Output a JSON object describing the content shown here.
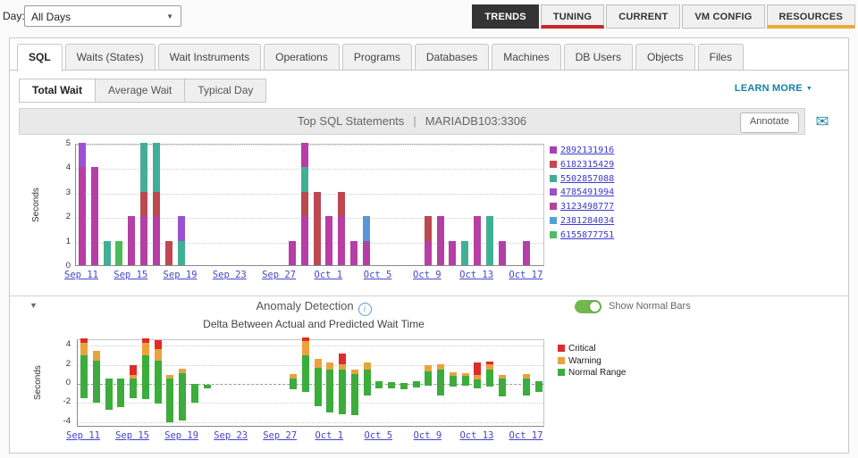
{
  "toolbar": {
    "day_label": "Day:",
    "day_value": "All Days",
    "nav_buttons": [
      {
        "label": "TRENDS",
        "active": true
      },
      {
        "label": "TUNING",
        "accent": "#C9252C"
      },
      {
        "label": "CURRENT"
      },
      {
        "label": "VM CONFIG"
      },
      {
        "label": "RESOURCES",
        "accent": "#EFA93B"
      }
    ]
  },
  "tabs": [
    "SQL",
    "Waits (States)",
    "Wait Instruments",
    "Operations",
    "Programs",
    "Databases",
    "Machines",
    "DB Users",
    "Objects",
    "Files"
  ],
  "active_tab": "SQL",
  "subtabs": [
    "Total Wait",
    "Average Wait",
    "Typical Day"
  ],
  "active_subtab": "Total Wait",
  "learn_more": {
    "label": "LEARN MORE"
  },
  "panel": {
    "title_left": "Top SQL Statements",
    "title_sep": "|",
    "title_right": "MARIADB103:3306",
    "annotate_label": "Annotate"
  },
  "anomaly": {
    "title": "Anomaly Detection",
    "toggle_label": "Show Normal Bars",
    "toggle_state": "on",
    "subtitle": "Delta Between Actual and Predicted Wait Time"
  },
  "icons": {
    "email": "✉",
    "caret": "▼",
    "collapse": "▼",
    "info": "i"
  },
  "chart_data": [
    {
      "type": "bar",
      "stacked": true,
      "title": "Top SQL Statements | MARIADB103:3306",
      "ylabel": "Seconds",
      "ylim": [
        0,
        5.2
      ],
      "yticks": [
        0,
        1,
        2,
        3,
        4,
        5
      ],
      "n_slots": 38,
      "tick_labels": [
        "Sep 11",
        "Sep 15",
        "Sep 19",
        "Sep 23",
        "Sep 27",
        "Oct 1",
        "Oct 5",
        "Oct 9",
        "Oct 13",
        "Oct 17"
      ],
      "tick_slots": [
        0,
        4,
        8,
        12,
        16,
        20,
        24,
        28,
        32,
        36
      ],
      "colors": {
        "magenta": "#B53FA5",
        "red": "#BB4A50",
        "teal": "#43AE96",
        "purple": "#9C52CE",
        "green": "#4CBB57",
        "blue": "#5599DB"
      },
      "legend": [
        {
          "label": "2892131916",
          "color": "#A93FB8"
        },
        {
          "label": "6182315429",
          "color": "#C44A4A"
        },
        {
          "label": "5502857088",
          "color": "#3EAE93"
        },
        {
          "label": "4785491994",
          "color": "#9C4FCB"
        },
        {
          "label": "3123498777",
          "color": "#B83FA0"
        },
        {
          "label": "2381284034",
          "color": "#55A0D9"
        },
        {
          "label": "6155877751",
          "color": "#4CBE63"
        }
      ],
      "bars": [
        {
          "slot": 0,
          "segments": [
            [
              "magenta",
              4
            ],
            [
              "purple",
              1
            ]
          ]
        },
        {
          "slot": 1,
          "segments": [
            [
              "magenta",
              4
            ]
          ]
        },
        {
          "slot": 2,
          "segments": [
            [
              "teal",
              1
            ]
          ]
        },
        {
          "slot": 3,
          "segments": [
            [
              "green",
              1
            ]
          ]
        },
        {
          "slot": 4,
          "segments": [
            [
              "magenta",
              2
            ]
          ]
        },
        {
          "slot": 5,
          "segments": [
            [
              "magenta",
              2
            ],
            [
              "red",
              1
            ],
            [
              "teal",
              2
            ]
          ]
        },
        {
          "slot": 6,
          "segments": [
            [
              "magenta",
              2
            ],
            [
              "red",
              1
            ],
            [
              "teal",
              2
            ]
          ]
        },
        {
          "slot": 7,
          "segments": [
            [
              "red",
              1
            ]
          ]
        },
        {
          "slot": 8,
          "segments": [
            [
              "teal",
              1
            ],
            [
              "purple",
              1
            ]
          ]
        },
        {
          "slot": 17,
          "segments": [
            [
              "magenta",
              1
            ]
          ]
        },
        {
          "slot": 18,
          "segments": [
            [
              "magenta",
              2
            ],
            [
              "red",
              1
            ],
            [
              "teal",
              1
            ],
            [
              "magenta",
              1
            ]
          ]
        },
        {
          "slot": 19,
          "segments": [
            [
              "red",
              3
            ]
          ]
        },
        {
          "slot": 20,
          "segments": [
            [
              "magenta",
              2
            ]
          ]
        },
        {
          "slot": 21,
          "segments": [
            [
              "magenta",
              2
            ],
            [
              "red",
              1
            ]
          ]
        },
        {
          "slot": 22,
          "segments": [
            [
              "magenta",
              1
            ]
          ]
        },
        {
          "slot": 23,
          "segments": [
            [
              "magenta",
              1
            ],
            [
              "blue",
              1
            ]
          ]
        },
        {
          "slot": 28,
          "segments": [
            [
              "magenta",
              1
            ],
            [
              "red",
              1
            ]
          ]
        },
        {
          "slot": 29,
          "segments": [
            [
              "magenta",
              2
            ]
          ]
        },
        {
          "slot": 30,
          "segments": [
            [
              "magenta",
              1
            ]
          ]
        },
        {
          "slot": 31,
          "segments": [
            [
              "teal",
              1
            ]
          ]
        },
        {
          "slot": 32,
          "segments": [
            [
              "magenta",
              2
            ]
          ]
        },
        {
          "slot": 33,
          "segments": [
            [
              "teal",
              2
            ]
          ]
        },
        {
          "slot": 34,
          "segments": [
            [
              "magenta",
              1
            ]
          ]
        },
        {
          "slot": 36,
          "segments": [
            [
              "magenta",
              1
            ]
          ]
        }
      ]
    },
    {
      "type": "bar",
      "subtype": "diverging-stacked",
      "title": "Delta Between Actual and Predicted Wait Time",
      "ylabel": "Seconds",
      "ylim": [
        -4.6,
        4.6
      ],
      "yticks": [
        -4,
        -2,
        0,
        2,
        4
      ],
      "n_slots": 38,
      "tick_labels": [
        "Sep 11",
        "Sep 15",
        "Sep 19",
        "Sep 23",
        "Sep 27",
        "Oct 1",
        "Oct 5",
        "Oct 9",
        "Oct 13",
        "Oct 17"
      ],
      "tick_slots": [
        0,
        4,
        8,
        12,
        16,
        20,
        24,
        28,
        32,
        36
      ],
      "legend": [
        {
          "label": "Critical",
          "color": "#DD2C2C"
        },
        {
          "label": "Warning",
          "color": "#E8A33C"
        },
        {
          "label": "Normal Range",
          "color": "#3CAC3C"
        }
      ],
      "bars": [
        {
          "slot": 0,
          "low": -1.5,
          "normal": 3.0,
          "warning": 4.3,
          "critical": 4.8
        },
        {
          "slot": 1,
          "low": -2.0,
          "normal": 2.4,
          "warning": 3.5
        },
        {
          "slot": 2,
          "low": -2.7,
          "normal": 0.6
        },
        {
          "slot": 3,
          "low": -2.4,
          "normal": 0.6
        },
        {
          "slot": 4,
          "low": -1.5,
          "normal": 0.6,
          "warning": 0.9,
          "critical": 2.0
        },
        {
          "slot": 5,
          "low": -1.6,
          "normal": 3.0,
          "warning": 4.3,
          "critical": 4.8
        },
        {
          "slot": 6,
          "low": -2.1,
          "normal": 2.4,
          "warning": 3.6,
          "critical": 4.6
        },
        {
          "slot": 7,
          "low": -4.0,
          "normal": 0.6,
          "warning": 0.9
        },
        {
          "slot": 8,
          "low": -3.8,
          "normal": 1.1,
          "warning": 1.6
        },
        {
          "slot": 9,
          "low": -2.0,
          "normal": 0.0
        },
        {
          "slot": 10,
          "low": -0.45,
          "normal": -0.1
        },
        {
          "slot": 17,
          "low": -0.6,
          "normal": 0.6,
          "warning": 1.0
        },
        {
          "slot": 18,
          "low": -0.8,
          "normal": 3.0,
          "warning": 4.5,
          "critical": 4.9
        },
        {
          "slot": 19,
          "low": -2.3,
          "normal": 1.7,
          "warning": 2.6
        },
        {
          "slot": 20,
          "low": -3.0,
          "normal": 1.5,
          "warning": 2.2
        },
        {
          "slot": 21,
          "low": -3.2,
          "normal": 1.5,
          "warning": 2.1,
          "critical": 3.2
        },
        {
          "slot": 22,
          "low": -3.3,
          "normal": 1.0,
          "warning": 1.5
        },
        {
          "slot": 23,
          "low": -1.2,
          "normal": 1.5,
          "warning": 2.2
        },
        {
          "slot": 24,
          "low": -0.5,
          "normal": 0.3
        },
        {
          "slot": 25,
          "low": -0.5,
          "normal": 0.2
        },
        {
          "slot": 26,
          "low": -0.6,
          "normal": 0.1
        },
        {
          "slot": 27,
          "low": -0.4,
          "normal": 0.3
        },
        {
          "slot": 28,
          "low": -0.2,
          "normal": 1.3,
          "warning": 2.0
        },
        {
          "slot": 29,
          "low": -1.2,
          "normal": 1.5,
          "warning": 2.1
        },
        {
          "slot": 30,
          "low": -0.3,
          "normal": 0.8,
          "warning": 1.2
        },
        {
          "slot": 31,
          "low": -0.2,
          "normal": 0.8,
          "warning": 1.1
        },
        {
          "slot": 32,
          "low": -0.5,
          "normal": 0.5,
          "warning": 0.9,
          "critical": 2.2
        },
        {
          "slot": 33,
          "low": -0.3,
          "normal": 1.5,
          "warning": 2.1,
          "critical": 2.3
        },
        {
          "slot": 34,
          "low": -1.3,
          "normal": 0.6,
          "warning": 0.9
        },
        {
          "slot": 36,
          "low": -1.2,
          "normal": 0.6,
          "warning": 1.0
        },
        {
          "slot": 37,
          "low": -0.8,
          "normal": 0.3
        }
      ]
    }
  ]
}
